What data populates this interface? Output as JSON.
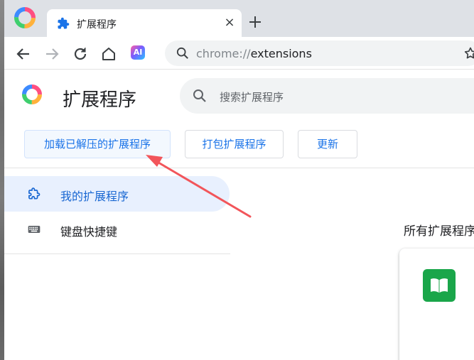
{
  "browser": {
    "tab_title": "扩展程序",
    "close_glyph": "×",
    "url_scheme": "chrome://",
    "url_path": "extensions",
    "ai_badge": "AI"
  },
  "page": {
    "title": "扩展程序",
    "search_placeholder": "搜索扩展程序",
    "buttons": {
      "load_unpacked": "加载已解压的扩展程序",
      "pack": "打包扩展程序",
      "update": "更新"
    }
  },
  "sidebar": {
    "items": [
      {
        "label": "我的扩展程序",
        "icon": "puzzle-piece-icon",
        "active": true
      },
      {
        "label": "键盘快捷键",
        "icon": "keyboard-icon",
        "active": false
      }
    ]
  },
  "main": {
    "section_title": "所有扩展程序"
  },
  "colors": {
    "accent": "#1a73e8",
    "active_nav_bg": "#e8f0fe",
    "arrow": "#f2555a",
    "card_icon": "#1aa64a"
  }
}
